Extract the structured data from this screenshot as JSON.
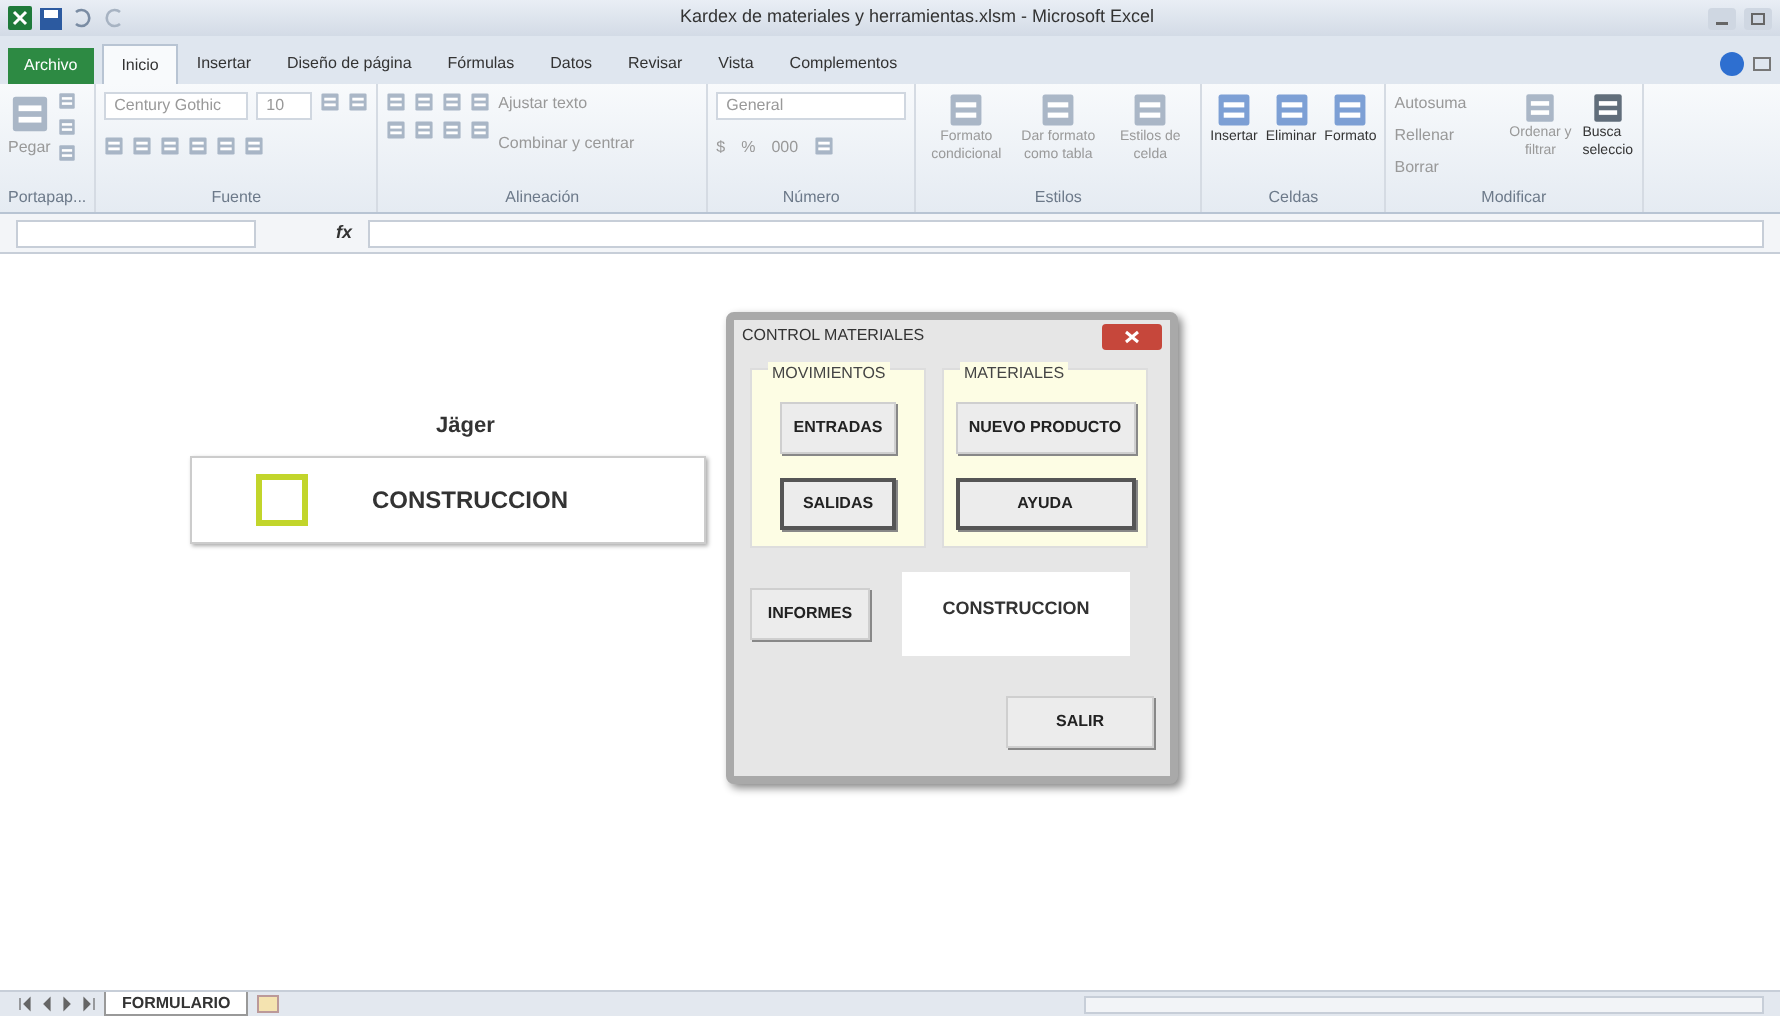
{
  "window": {
    "title": "Kardex de materiales y herramientas.xlsm - Microsoft Excel"
  },
  "tabs": [
    {
      "label": "Archivo",
      "kind": "file",
      "selected": false
    },
    {
      "label": "Inicio",
      "kind": "tab",
      "selected": true
    },
    {
      "label": "Insertar",
      "kind": "tab",
      "selected": false
    },
    {
      "label": "Diseño de página",
      "kind": "tab",
      "selected": false
    },
    {
      "label": "Fórmulas",
      "kind": "tab",
      "selected": false
    },
    {
      "label": "Datos",
      "kind": "tab",
      "selected": false
    },
    {
      "label": "Revisar",
      "kind": "tab",
      "selected": false
    },
    {
      "label": "Vista",
      "kind": "tab",
      "selected": false
    },
    {
      "label": "Complementos",
      "kind": "tab",
      "selected": false
    }
  ],
  "ribbon": {
    "clipboard": {
      "paste": "Pegar",
      "group": "Portapap..."
    },
    "font": {
      "name": "Century Gothic",
      "size": "10",
      "group": "Fuente"
    },
    "alignment": {
      "wrap": "Ajustar texto",
      "merge": "Combinar y centrar",
      "group": "Alineación"
    },
    "number": {
      "format": "General",
      "currency": "$",
      "percent": "%",
      "thousands": "000",
      "group": "Número"
    },
    "styles": {
      "buttons": [
        "Formato condicional",
        "Dar formato como tabla",
        "Estilos de celda"
      ],
      "group": "Estilos"
    },
    "cells": {
      "buttons": [
        "Insertar",
        "Eliminar",
        "Formato"
      ],
      "group": "Celdas"
    },
    "editing": {
      "autosum": "Autosuma",
      "fill": "Rellenar",
      "clear": "Borrar",
      "sort": "Ordenar y filtrar",
      "find": [
        "Busca",
        "seleccio"
      ],
      "group": "Modificar"
    }
  },
  "formula_bar": {
    "fx": "fx"
  },
  "sheet": {
    "label": "Jäger",
    "card_text": "CONSTRUCCION"
  },
  "dialog": {
    "title": "CONTROL MATERIALES",
    "frames": [
      {
        "title": "MOVIMIENTOS",
        "buttons": [
          {
            "label": "ENTRADAS",
            "focused": false
          },
          {
            "label": "SALIDAS",
            "focused": true
          }
        ]
      },
      {
        "title": "MATERIALES",
        "buttons": [
          {
            "label": "NUEVO PRODUCTO",
            "focused": false
          },
          {
            "label": "AYUDA",
            "focused": true
          }
        ]
      }
    ],
    "informes": "INFORMES",
    "label": "CONSTRUCCION",
    "salir": "SALIR"
  },
  "sheet_tabs": [
    {
      "label": "FORMULARIO",
      "selected": true
    }
  ]
}
